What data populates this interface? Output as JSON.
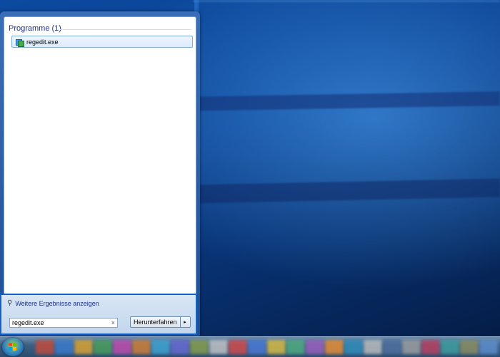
{
  "start_menu": {
    "group_header": "Programme (1)",
    "result_item": "regedit.exe",
    "more_results": "Weitere Ergebnisse anzeigen",
    "search": {
      "value": "regedit.exe",
      "clear_glyph": "×"
    },
    "shutdown": {
      "label": "Herunterfahren",
      "arrow_glyph": "▸"
    },
    "more_results_icon": "search-icon"
  },
  "colors": {
    "group_header": "#1e3287",
    "selection_border": "#84acdd",
    "highlight_border": "#1560c8"
  },
  "taskbar": {
    "tiles": [
      "#c84b3a",
      "#3a7ccf",
      "#e0a630",
      "#4aa25a",
      "#c84bb0",
      "#d98034",
      "#3fa7d6",
      "#6a6ad6",
      "#8aa04a",
      "#c8c8c8",
      "#d94a4a",
      "#4a7ad9",
      "#e0c040",
      "#50b080",
      "#a060c0",
      "#f09030",
      "#3090c0",
      "#c0c0c0",
      "#5070a0",
      "#a0a0a0",
      "#c04060",
      "#40a0a0",
      "#909060",
      "#6090d0"
    ]
  }
}
